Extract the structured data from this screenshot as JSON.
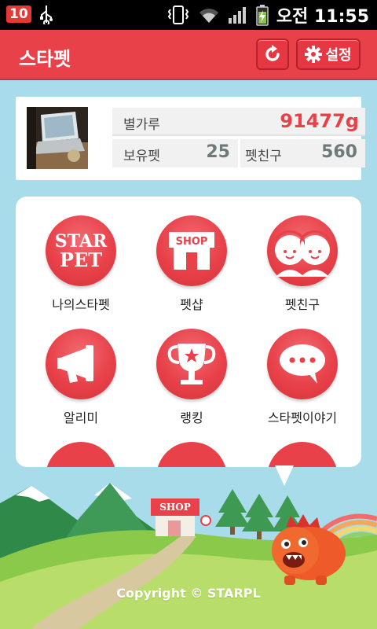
{
  "status_bar": {
    "carrier_badge": "10",
    "time_period": "오전",
    "time": "11:55"
  },
  "header": {
    "title": "스타펫",
    "settings_label": "설정",
    "refresh_icon": "refresh-icon",
    "settings_icon": "gear-icon"
  },
  "profile": {
    "stars": {
      "label": "별가루",
      "value": "91477g"
    },
    "owned_pets": {
      "label": "보유펫",
      "value": "25"
    },
    "pet_friends": {
      "label": "펫친구",
      "value": "560"
    }
  },
  "menu": {
    "items": [
      {
        "label": "나의스타펫",
        "icon": "starpet-logo-icon",
        "logo_text": "STAR PET"
      },
      {
        "label": "펫샵",
        "icon": "shop-icon",
        "logo_text": "SHOP"
      },
      {
        "label": "펫친구",
        "icon": "friends-icon"
      },
      {
        "label": "알리미",
        "icon": "megaphone-icon"
      },
      {
        "label": "랭킹",
        "icon": "trophy-icon"
      },
      {
        "label": "스타펫이야기",
        "icon": "chat-bubble-icon"
      }
    ]
  },
  "scene": {
    "shop_sign": "SHOP",
    "copyright": "Copyright © STARPL"
  },
  "colors": {
    "primary_red": "#e8414a",
    "value_gray": "#6d7a78",
    "sky": "#a8dcea"
  }
}
